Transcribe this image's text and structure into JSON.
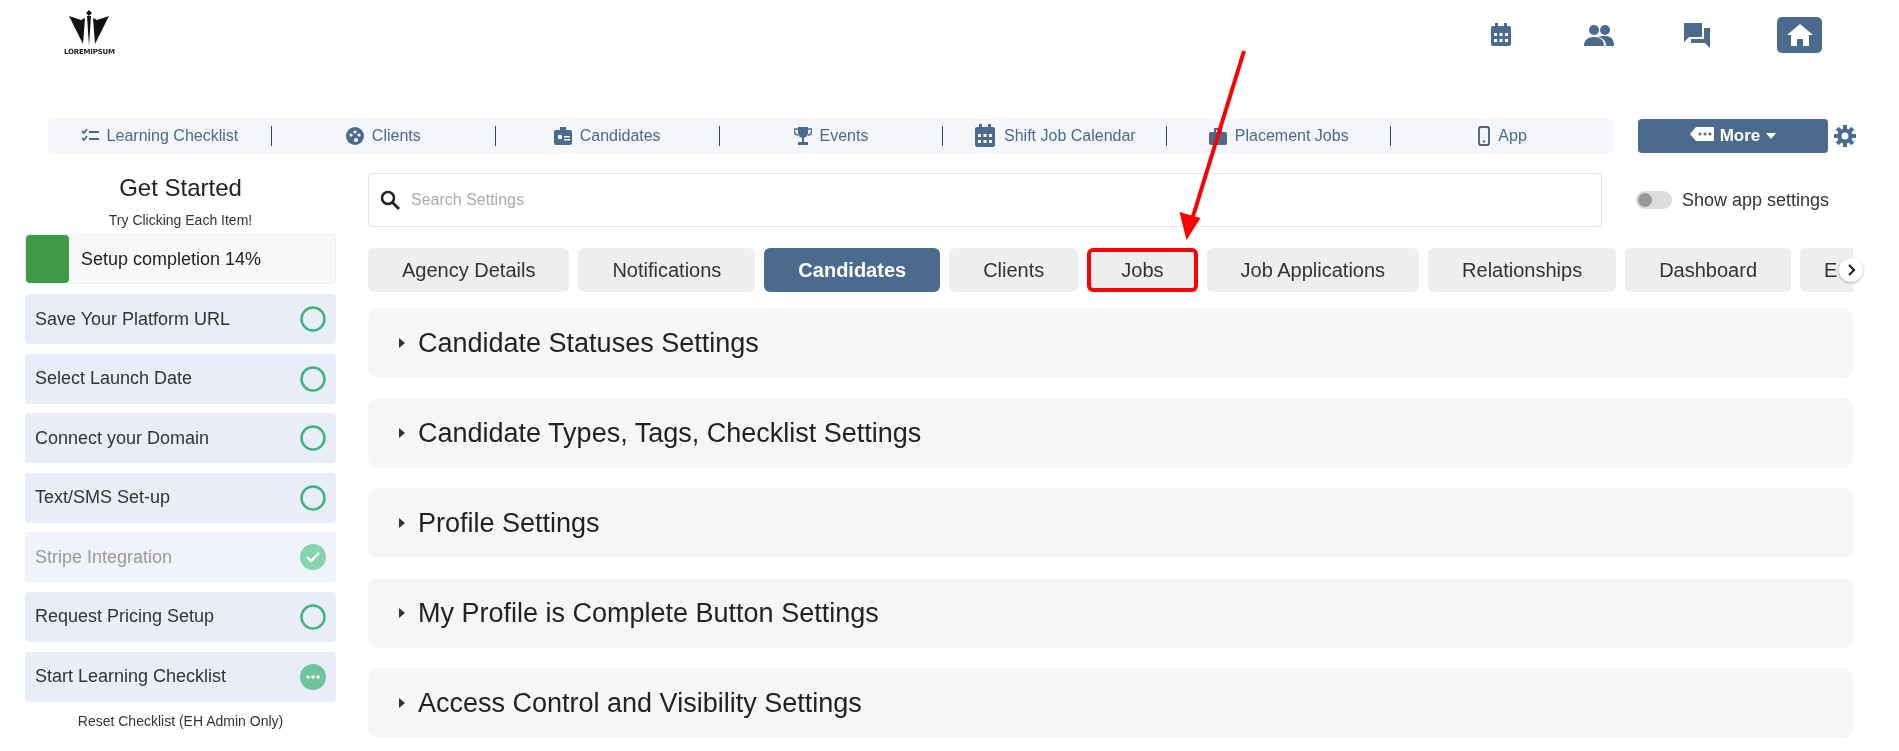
{
  "logo": {
    "text": "LOREMIPSUM"
  },
  "header_icons": [
    {
      "kind": "calendar",
      "selected": false
    },
    {
      "kind": "people",
      "selected": false
    },
    {
      "kind": "chat",
      "selected": false
    },
    {
      "kind": "home",
      "selected": true
    }
  ],
  "nav": {
    "items": [
      {
        "label": "Learning Checklist"
      },
      {
        "label": "Clients"
      },
      {
        "label": "Candidates"
      },
      {
        "label": "Events"
      },
      {
        "label": "Shift Job Calendar"
      },
      {
        "label": "Placement Jobs"
      },
      {
        "label": "App"
      }
    ],
    "more_button": "More"
  },
  "sidebar": {
    "title": "Get Started",
    "subtitle": "Try Clicking Each Item!",
    "progress": {
      "label": "Setup completion 14%",
      "level": 0.14
    },
    "items": [
      {
        "label": "Save Your Platform URL",
        "kind": "todo"
      },
      {
        "label": "Select Launch Date",
        "kind": "todo"
      },
      {
        "label": "Connect your Domain",
        "kind": "todo"
      },
      {
        "label": "Text/SMS Set-up",
        "kind": "todo"
      },
      {
        "label": "Stripe Integration",
        "kind": "done"
      },
      {
        "label": "Request Pricing Setup",
        "kind": "todo"
      },
      {
        "label": "Start Learning Checklist",
        "kind": "pending"
      }
    ],
    "reset_link": "Reset Checklist (EH Admin Only)"
  },
  "search": {
    "placeholder": "Search Settings"
  },
  "app_settings_toggle": {
    "label": "Show app settings",
    "on": false
  },
  "tabs": [
    {
      "label": "Agency Details",
      "selected": false,
      "highlighted": false
    },
    {
      "label": "Notifications",
      "selected": false,
      "highlighted": false
    },
    {
      "label": "Candidates",
      "selected": true,
      "highlighted": false
    },
    {
      "label": "Clients",
      "selected": false,
      "highlighted": false
    },
    {
      "label": "Jobs",
      "selected": false,
      "highlighted": true
    },
    {
      "label": "Job Applications",
      "selected": false,
      "highlighted": false
    },
    {
      "label": "Relationships",
      "selected": false,
      "highlighted": false
    },
    {
      "label": "Dashboard",
      "selected": false,
      "highlighted": false
    },
    {
      "label": "E",
      "selected": false,
      "highlighted": false
    }
  ],
  "sections": [
    {
      "title": "Candidate Statuses Settings",
      "expanded": false
    },
    {
      "title": "Candidate Types, Tags, Checklist Settings",
      "expanded": false
    },
    {
      "title": "Profile Settings",
      "expanded": false
    },
    {
      "title": "My Profile is Complete Button Settings",
      "expanded": false
    },
    {
      "title": "Access Control and Visibility Settings",
      "expanded": false
    }
  ]
}
